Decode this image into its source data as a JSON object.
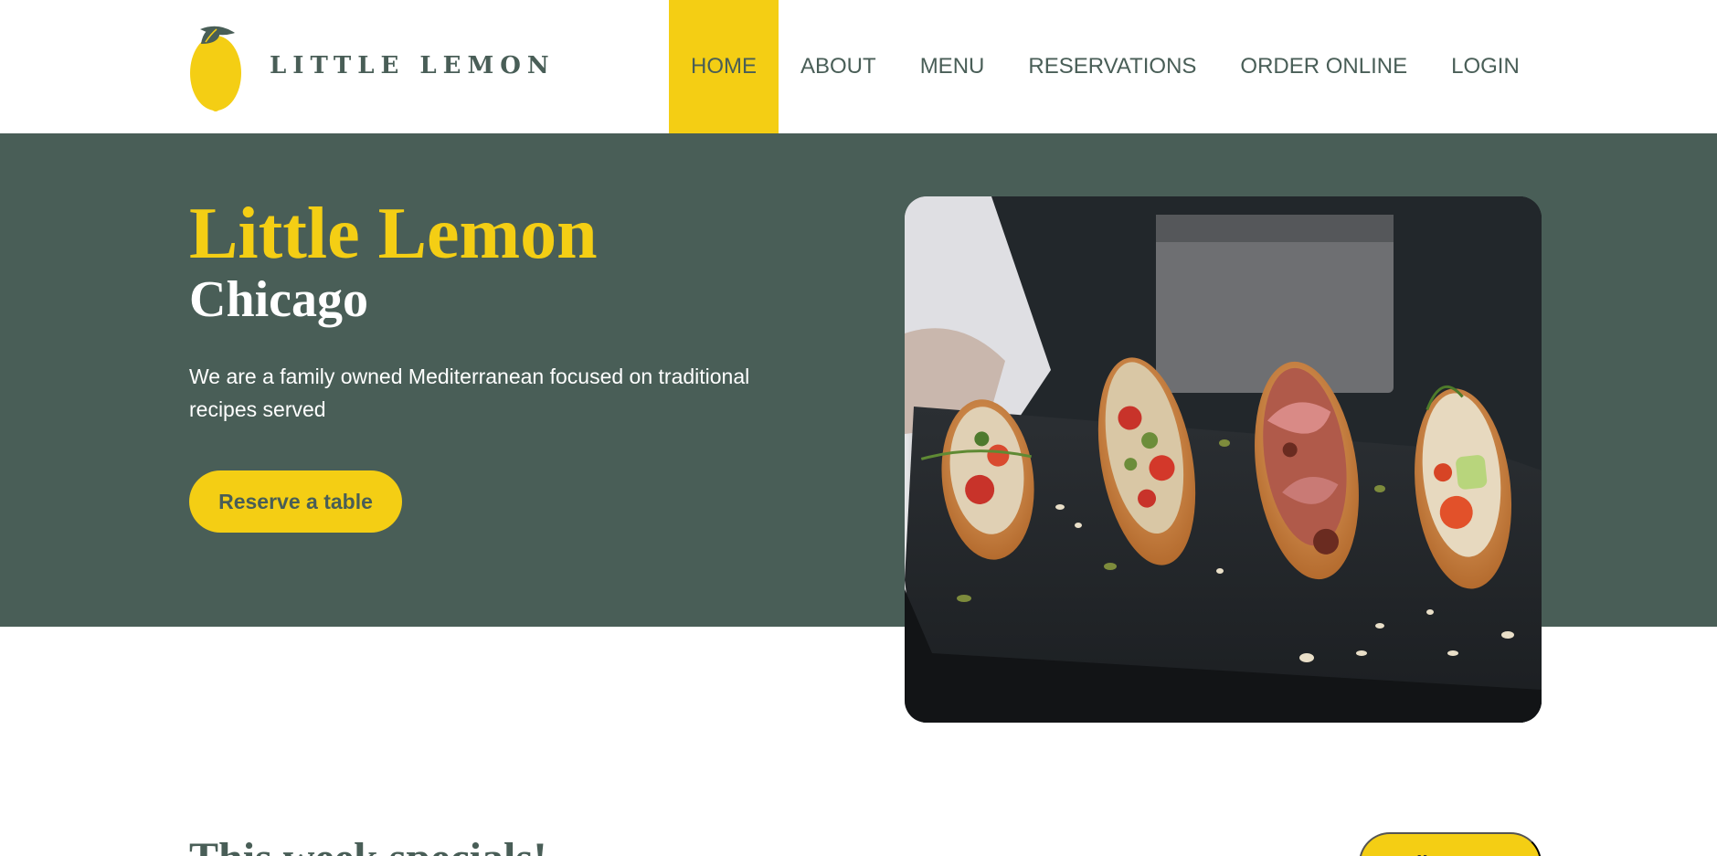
{
  "colors": {
    "primary_green": "#495e57",
    "primary_yellow": "#f4ce14",
    "white": "#ffffff"
  },
  "header": {
    "logo_icon": "lemon-icon",
    "logo_text": "LITTLE LEMON",
    "nav": [
      {
        "label": "HOME",
        "active": true
      },
      {
        "label": "ABOUT",
        "active": false
      },
      {
        "label": "MENU",
        "active": false
      },
      {
        "label": "RESERVATIONS",
        "active": false
      },
      {
        "label": "ORDER ONLINE",
        "active": false
      },
      {
        "label": "LOGIN",
        "active": false
      }
    ]
  },
  "hero": {
    "title": "Little Lemon",
    "subtitle": "Chicago",
    "description": "We are a family owned Mediterranean focused on traditional recipes served",
    "cta_label": "Reserve a table",
    "image_subject": "bruschetta-on-slate-photo"
  },
  "specials": {
    "title": "This week specials!",
    "button_label": "Online Menu"
  }
}
